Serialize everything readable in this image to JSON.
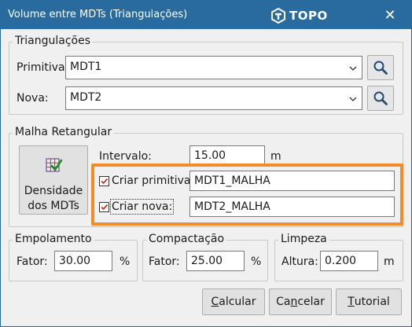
{
  "window": {
    "title": "Volume entre MDTs (Triangulações)",
    "logo_text": "TOPO"
  },
  "triangulacoes": {
    "group_label": "Triangulações",
    "primitiva": {
      "label": "Primitiva:",
      "value": "MDT1"
    },
    "nova": {
      "label": "Nova:",
      "value": "MDT2"
    }
  },
  "malha": {
    "group_label": "Malha Retangular",
    "densidade_button": {
      "line1": "Densidade",
      "line2": "dos MDTs"
    },
    "intervalo": {
      "label": "Intervalo:",
      "value": "15.00",
      "unit": "m"
    },
    "criar_primitiva": {
      "label": "Criar primitiva:",
      "checked": true,
      "value": "MDT1_MALHA"
    },
    "criar_nova": {
      "label": "Criar nova:",
      "checked": true,
      "value": "MDT2_MALHA"
    }
  },
  "empolamento": {
    "group_label": "Empolamento",
    "label": "Fator:",
    "value": "30.00",
    "unit": "%"
  },
  "compactacao": {
    "group_label": "Compactação",
    "label": "Fator:",
    "value": "25.00",
    "unit": "%"
  },
  "limpeza": {
    "group_label": "Limpeza",
    "label": "Altura:",
    "value": "0.200",
    "unit": "m"
  },
  "buttons": {
    "calcular": {
      "mnemonic": "C",
      "rest": "alcular"
    },
    "cancelar": {
      "pre": "Ca",
      "mnemonic": "n",
      "rest": "celar"
    },
    "tutorial": {
      "mnemonic": "T",
      "rest": "utorial"
    }
  },
  "icons": {
    "close": "close-icon",
    "search": "search-icon",
    "grid": "grid-check-icon",
    "dropdown": "chevron-down-icon",
    "logo": "topo-logo-icon"
  },
  "colors": {
    "titlebar": "#2a6b9f",
    "highlight": "#f28c28",
    "check": "#c0392b"
  }
}
